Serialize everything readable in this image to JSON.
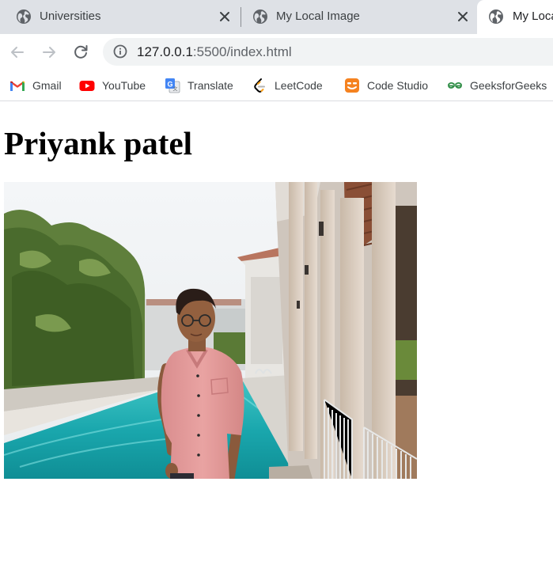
{
  "tabs": [
    {
      "title": "Universities",
      "icon": "globe-icon",
      "active": false
    },
    {
      "title": "My Local Image",
      "icon": "globe-icon",
      "active": false
    },
    {
      "title": "My Loca",
      "icon": "globe-icon",
      "active": true
    }
  ],
  "address_bar": {
    "url_host": "127.0.0.1",
    "url_rest": ":5500/index.html",
    "icon": "info-icon"
  },
  "bookmarks": [
    {
      "label": "Gmail",
      "icon": "gmail-icon"
    },
    {
      "label": "YouTube",
      "icon": "youtube-icon"
    },
    {
      "label": "Translate",
      "icon": "translate-icon"
    },
    {
      "label": "LeetCode",
      "icon": "leetcode-icon"
    },
    {
      "label": "Code Studio",
      "icon": "code-studio-icon"
    },
    {
      "label": "GeeksforGeeks",
      "icon": "geeksforgeeks-icon"
    }
  ],
  "page": {
    "heading": "Priyank patel",
    "image": "photo of a man in a pink shirt standing beside a swimming pool"
  },
  "colors": {
    "tab_strip": "#dee1e6",
    "omnibox": "#f1f3f4",
    "text": "#3c4043"
  }
}
